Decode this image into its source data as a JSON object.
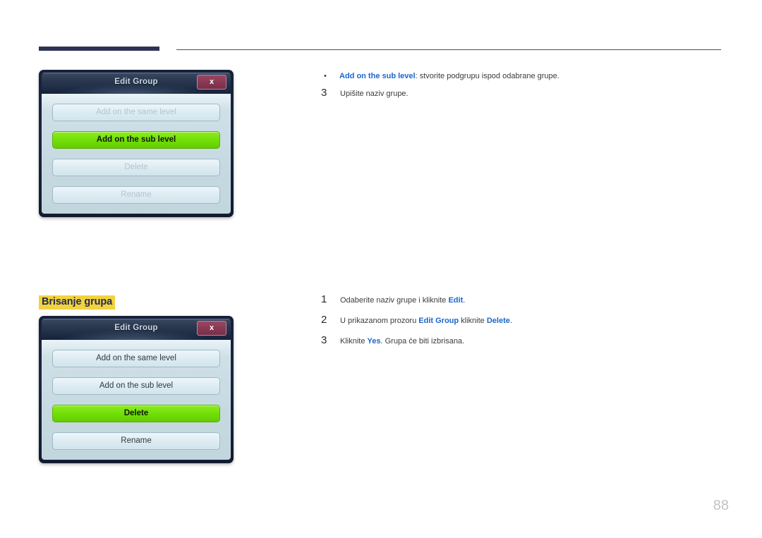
{
  "page": {
    "number": "88",
    "section_heading": "Brisanje grupa"
  },
  "dialog_top": {
    "title": "Edit Group",
    "close_label": "x",
    "buttons": [
      {
        "label": "Add on the same level",
        "state": "disabled"
      },
      {
        "label": "Add on the sub level",
        "state": "selected"
      },
      {
        "label": "Delete",
        "state": "disabled"
      },
      {
        "label": "Rename",
        "state": "disabled"
      }
    ]
  },
  "dialog_bottom": {
    "title": "Edit Group",
    "close_label": "x",
    "buttons": [
      {
        "label": "Add on the same level",
        "state": "enabled"
      },
      {
        "label": "Add on the sub level",
        "state": "enabled"
      },
      {
        "label": "Delete",
        "state": "selected"
      },
      {
        "label": "Rename",
        "state": "enabled"
      }
    ]
  },
  "steps_top": [
    {
      "marker": "•",
      "type": "bullet",
      "parts": [
        {
          "text": "Add on the sub level",
          "kw": true
        },
        {
          "text": ": stvorite podgrupu ispod odabrane grupe.",
          "kw": false
        }
      ]
    },
    {
      "marker": "3",
      "type": "number",
      "parts": [
        {
          "text": "Upišite naziv grupe.",
          "kw": false
        }
      ]
    }
  ],
  "steps_bottom": [
    {
      "marker": "1",
      "type": "number",
      "parts": [
        {
          "text": "Odaberite naziv grupe i kliknite ",
          "kw": false
        },
        {
          "text": "Edit",
          "kw": true
        },
        {
          "text": ".",
          "kw": false
        }
      ]
    },
    {
      "marker": "2",
      "type": "number",
      "parts": [
        {
          "text": "U prikazanom prozoru ",
          "kw": false
        },
        {
          "text": "Edit Group",
          "kw": true
        },
        {
          "text": " kliknite ",
          "kw": false
        },
        {
          "text": "Delete",
          "kw": true
        },
        {
          "text": ".",
          "kw": false
        }
      ]
    },
    {
      "marker": "3",
      "type": "number",
      "parts": [
        {
          "text": "Kliknite ",
          "kw": false
        },
        {
          "text": "Yes",
          "kw": true
        },
        {
          "text": ". Grupa će biti izbrisana.",
          "kw": false
        }
      ]
    }
  ],
  "colors": {
    "accent_blue": "#1c66c9",
    "highlight_yellow": "#f2d23f",
    "rule_navy": "#2e3355",
    "selected_green": "#74e008",
    "close_maroon": "#8b3a55"
  }
}
